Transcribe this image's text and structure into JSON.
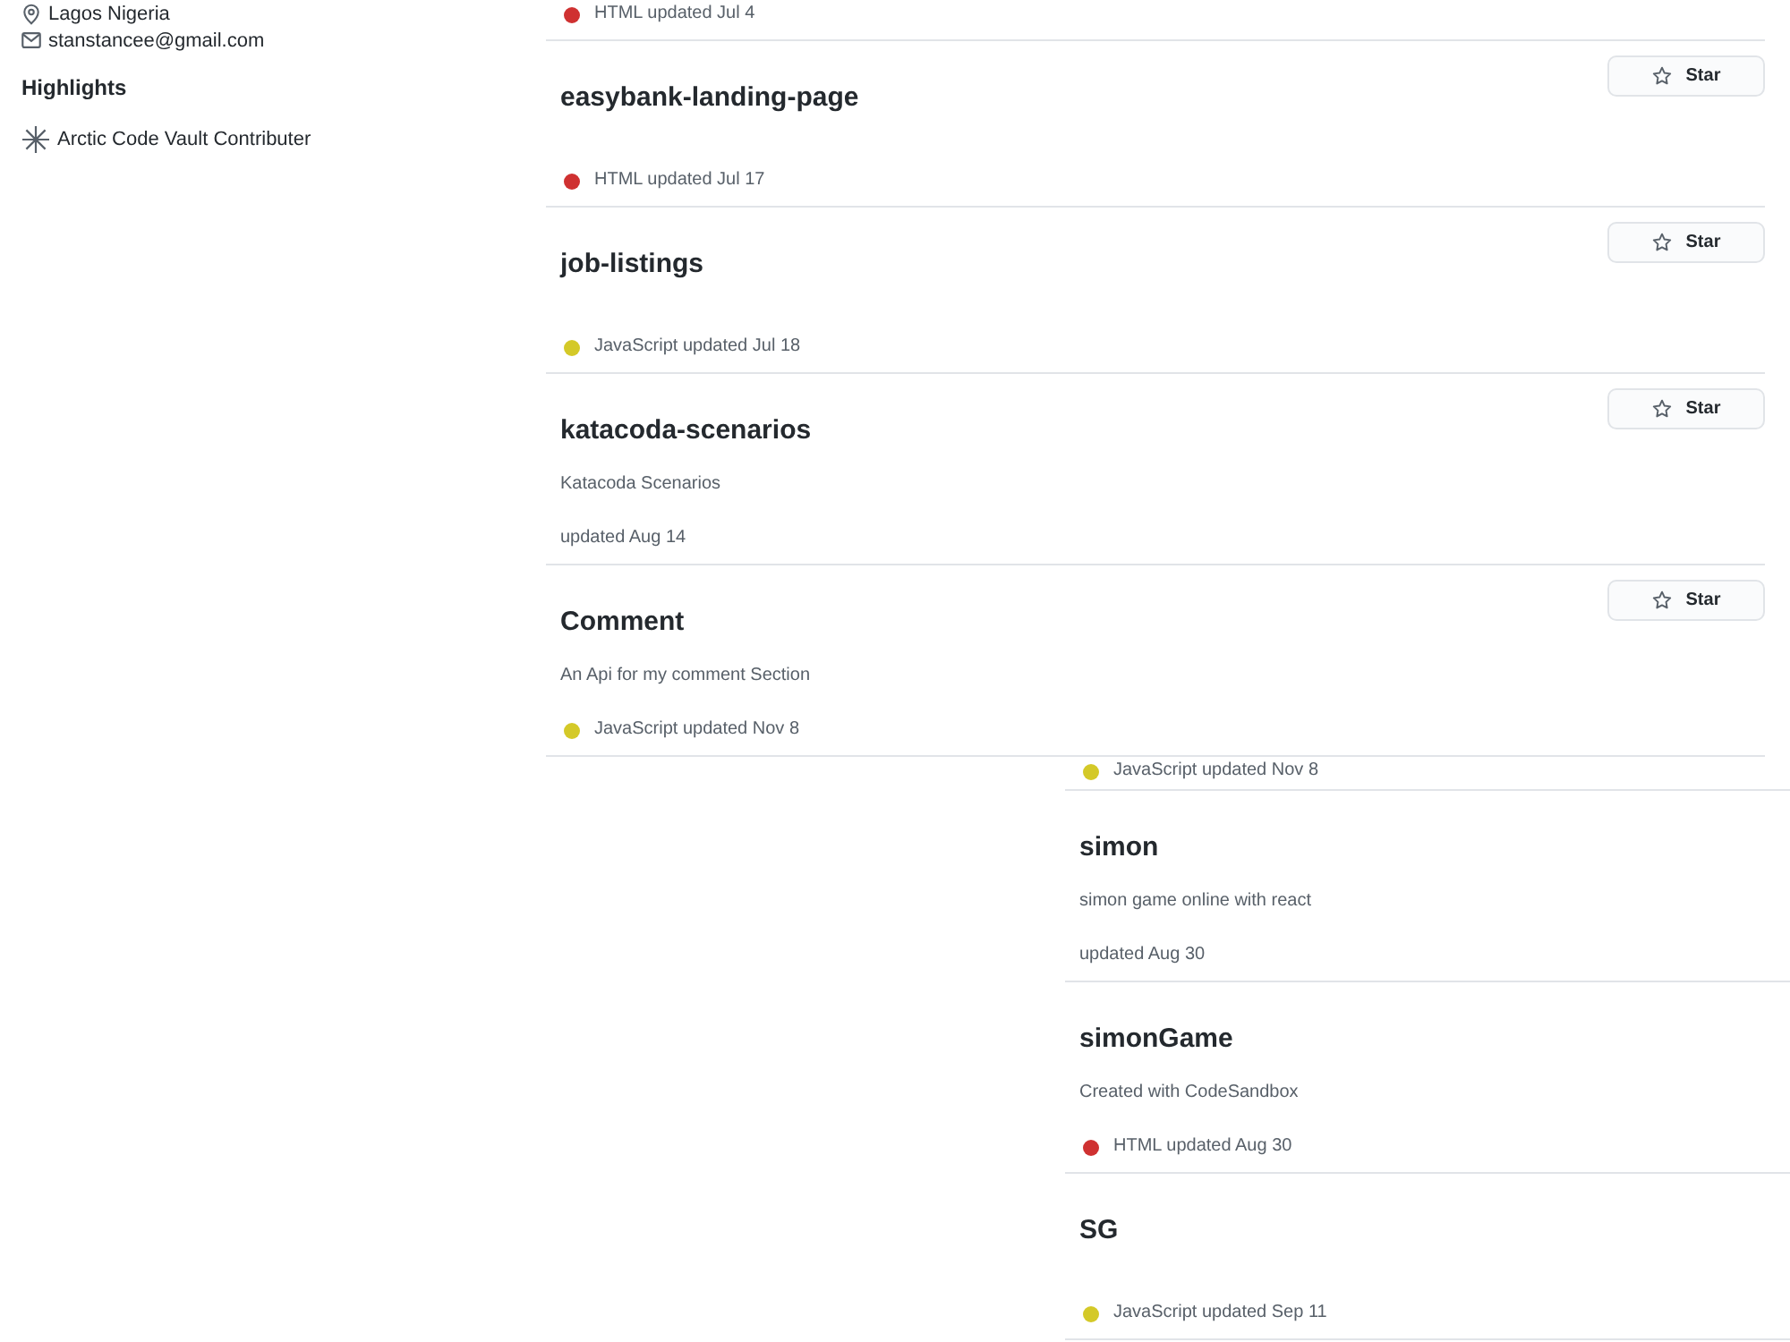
{
  "sidebar": {
    "location": "Lagos Nigeria",
    "email": "stanstancee@gmail.com",
    "highlights_title": "Highlights",
    "highlights": [
      {
        "label": "Arctic Code Vault Contributer"
      }
    ]
  },
  "repositories": [
    {
      "meta": "HTML updated Jul 4",
      "color": "#cf3131"
    },
    {
      "name": "easybank-landing-page",
      "star": "Star",
      "meta": "HTML updated Jul 17",
      "color": "#cf3131"
    },
    {
      "name": "job-listings",
      "star": "Star",
      "meta": "JavaScript updated Jul 18",
      "color": "#d4c928"
    },
    {
      "name": "katacoda-scenarios",
      "star": "Star",
      "description": "Katacoda Scenarios",
      "meta": "updated Aug 14"
    },
    {
      "name": "Comment",
      "star": "Star",
      "description": "An Api for my comment Section",
      "meta": "JavaScript updated Nov 8",
      "color": "#d4c928"
    }
  ],
  "repositories_continued": [
    {
      "meta": "JavaScript updated Nov 8",
      "color": "#d4c928"
    },
    {
      "name": "simon",
      "description": "simon game online with react",
      "meta": "updated Aug 30"
    },
    {
      "name": "simonGame",
      "description": "Created with CodeSandbox",
      "meta": "HTML updated Aug 30",
      "color": "#cf3131"
    },
    {
      "name": "SG",
      "meta": "JavaScript updated Sep 11",
      "color": "#d4c928"
    }
  ]
}
